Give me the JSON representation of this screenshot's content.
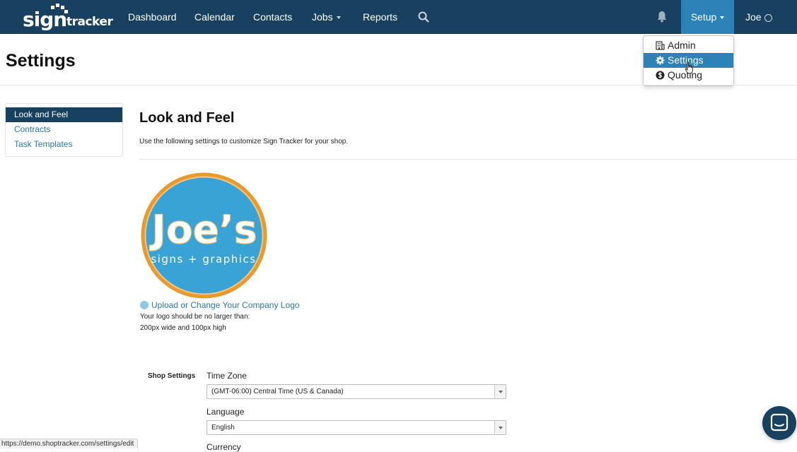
{
  "navbar": {
    "brand": {
      "sign": "sign",
      "tracker": "tracker"
    },
    "items": [
      {
        "label": "Dashboard"
      },
      {
        "label": "Calendar"
      },
      {
        "label": "Contacts"
      },
      {
        "label": "Jobs"
      },
      {
        "label": "Reports"
      }
    ],
    "setup_label": "Setup",
    "user_label": "Joe",
    "icons": {
      "search": "search-icon",
      "notifications": "bell-icon",
      "user": "user-circle-icon"
    }
  },
  "setup_menu": {
    "items": [
      {
        "label": "Admin",
        "icon": "building-icon"
      },
      {
        "label": "Settings",
        "icon": "gear-icon",
        "active": true
      },
      {
        "label": "Quoting",
        "icon": "dollar-circle-icon"
      }
    ]
  },
  "page": {
    "title": "Settings"
  },
  "sidebar": {
    "items": [
      {
        "label": "Look and Feel",
        "active": true
      },
      {
        "label": "Contracts"
      },
      {
        "label": "Task Templates"
      }
    ]
  },
  "look_and_feel": {
    "title": "Look and Feel",
    "description": "Use the following settings to customize Sign Tracker for your shop.",
    "logo": {
      "line1": "Joe’s",
      "line2": "signs + graphics"
    },
    "upload_link": "Upload or Change Your Company Logo",
    "hint_line1": "Your logo should be no larger than:",
    "hint_line2": "200px wide and 100px high"
  },
  "shop_settings": {
    "label": "Shop Settings",
    "time_zone": {
      "label": "Time Zone",
      "value": "(GMT-06:00) Central Time (US & Canada)"
    },
    "language": {
      "label": "Language",
      "value": "English"
    },
    "currency": {
      "label": "Currency"
    }
  },
  "status_bar": {
    "url": "https://demo.shoptracker.com/settings/edit"
  },
  "colors": {
    "navbar": "#17415f",
    "accent": "#2a82b7",
    "link": "#2a77ad",
    "logo_blue": "#3aa3d6",
    "logo_ring": "#e99a2f"
  }
}
